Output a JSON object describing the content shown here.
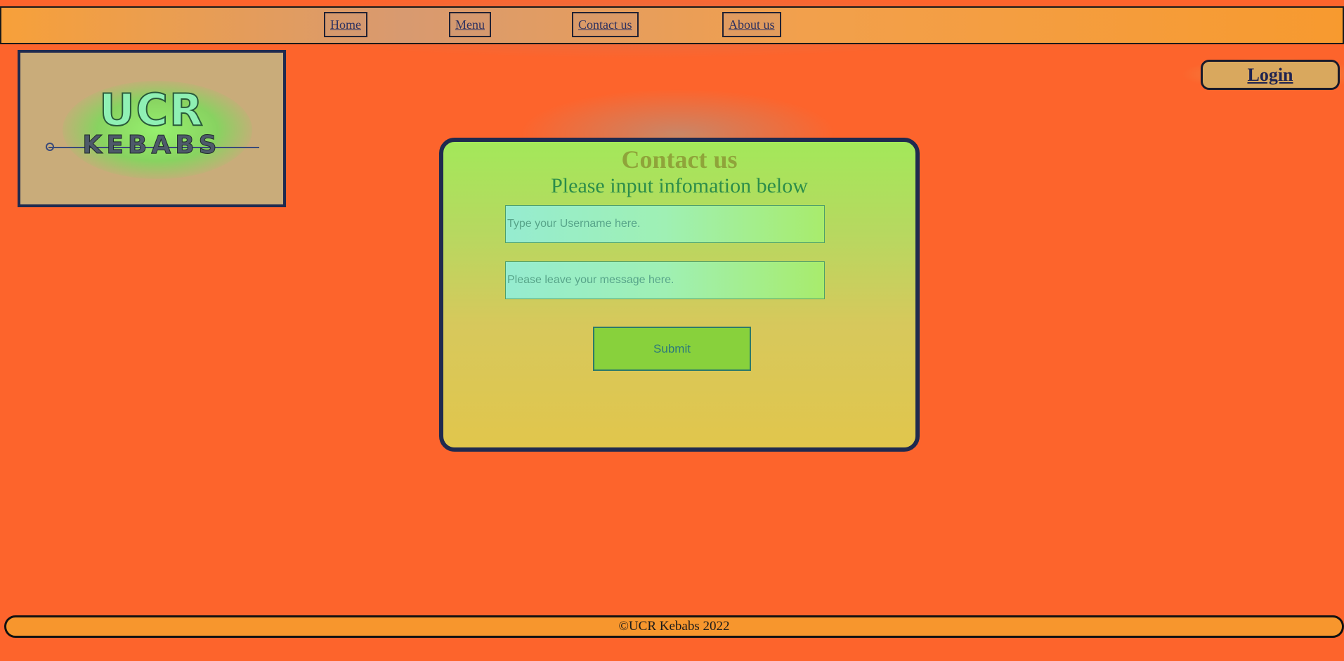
{
  "nav": {
    "items": [
      {
        "label": "Home"
      },
      {
        "label": "Menu"
      },
      {
        "label": "Contact us"
      },
      {
        "label": "About us"
      }
    ]
  },
  "logo": {
    "line1": "UCR",
    "line2": "KEBABS"
  },
  "header": {
    "login_label": "Login"
  },
  "contact": {
    "title": "Contact us",
    "subtitle": "Please input infomation below",
    "username_placeholder": "Type your Username here.",
    "message_placeholder": "Please leave your message here.",
    "submit_label": "Submit"
  },
  "footer": {
    "text": "©UCR Kebabs 2022"
  },
  "colors": {
    "background": "#fd642c",
    "navbar": "#f79a2f",
    "border": "#1f2a4f"
  }
}
